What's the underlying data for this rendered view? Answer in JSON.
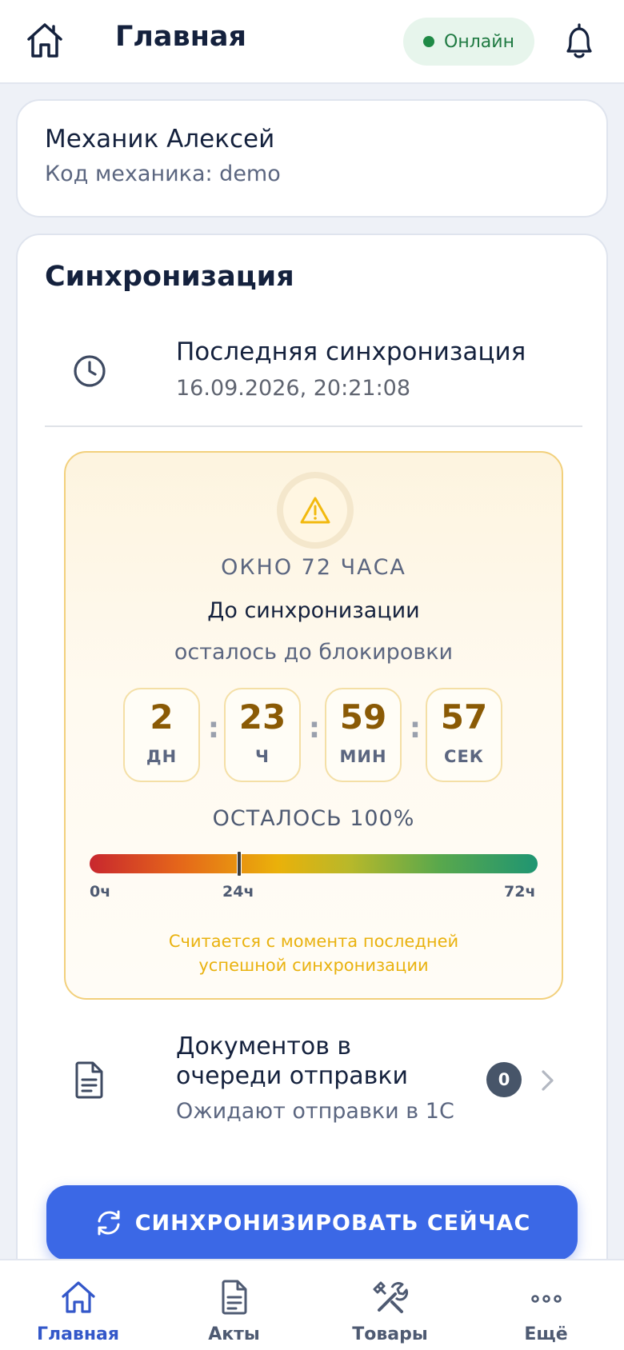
{
  "header": {
    "title": "Главная",
    "status": "Онлайн",
    "home_icon": "home-icon",
    "bell_icon": "bell-icon"
  },
  "profile": {
    "name": "Механик Алексей",
    "code": "Код механика: demo"
  },
  "sync": {
    "title": "Синхронизация",
    "last_label": "Последняя синхронизация",
    "last_value": "16.09.2026, 20:21:08",
    "window": {
      "title": "ОКНО 72 ЧАСА",
      "until": "До синхронизации",
      "block": "осталось до блокировки",
      "countdown": [
        {
          "value": "2",
          "unit": "ДН"
        },
        {
          "value": "23",
          "unit": "Ч"
        },
        {
          "value": "59",
          "unit": "МИН"
        },
        {
          "value": "57",
          "unit": "СЕК"
        }
      ],
      "separator": ":",
      "remaining_label": "ОСТАЛОСЬ 100%",
      "remaining_fraction": 1.0,
      "marker_hours": 24,
      "total_hours": 72,
      "ticks": [
        "0ч",
        "24ч",
        "72ч"
      ],
      "note": "Считается с момента последней успешной синхронизации"
    },
    "queue": {
      "title": "Документов в очереди отправки",
      "subtitle": "Ожидают отправки в 1С",
      "count": "0"
    },
    "button_label": "СИНХРОНИЗИРОВАТЬ СЕЙЧАС"
  },
  "nav": {
    "items": [
      {
        "label": "Главная",
        "icon": "home-icon",
        "active": true
      },
      {
        "label": "Акты",
        "icon": "document-icon",
        "active": false
      },
      {
        "label": "Товары",
        "icon": "tools-icon",
        "active": false
      },
      {
        "label": "Ещё",
        "icon": "more-icon",
        "active": false
      }
    ]
  },
  "colors": {
    "accent": "#3b68e6",
    "online": "#1f8a46",
    "warning_border": "#f2d07c",
    "countdown_value": "#8a5a05",
    "note": "#e9b20f"
  }
}
